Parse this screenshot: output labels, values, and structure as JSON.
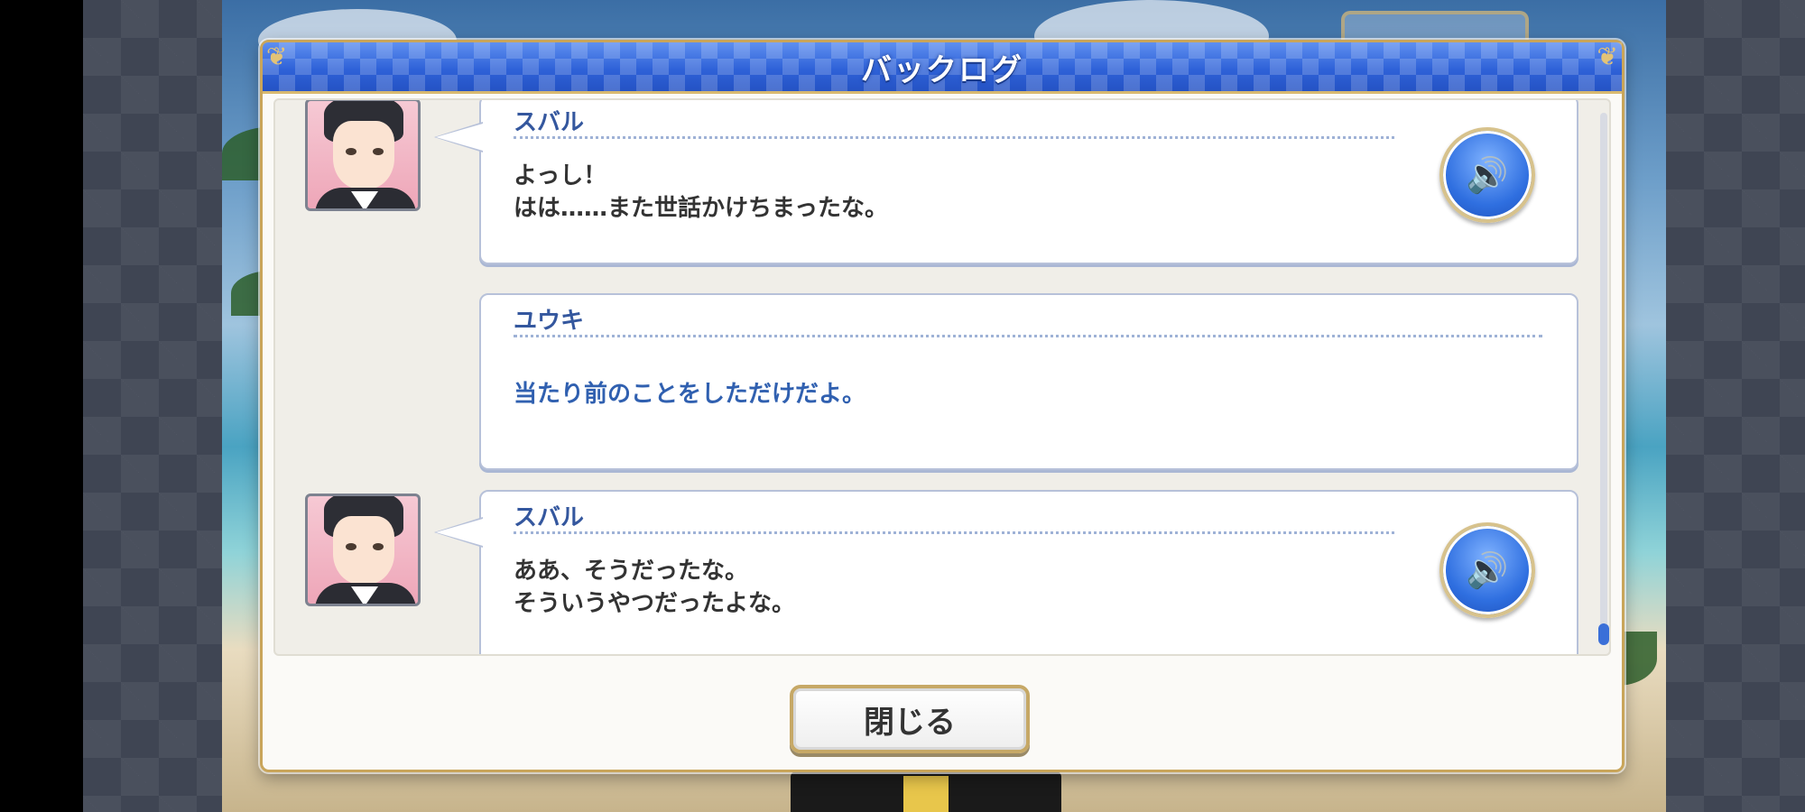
{
  "dialog": {
    "title": "バックログ",
    "close_label": "閉じる"
  },
  "entries": [
    {
      "speaker": "スバル",
      "lines": [
        "よっし！",
        "はは……また世話かけちまったな。"
      ],
      "has_voice": true,
      "has_avatar": true
    },
    {
      "speaker": "ユウキ",
      "lines": [
        "当たり前のことをしただけだよ。"
      ],
      "has_voice": false,
      "has_avatar": false
    },
    {
      "speaker": "スバル",
      "lines": [
        "ああ、そうだったな。",
        "そういうやつだったよな。"
      ],
      "has_voice": true,
      "has_avatar": true
    }
  ],
  "icons": {
    "voice": "speaker-icon",
    "corner": "ornament-icon"
  },
  "colors": {
    "title_bar": "#2f62d8",
    "speaker_name": "#34579e",
    "player_text": "#3060b0",
    "frame_gold": "#c9a55a"
  }
}
